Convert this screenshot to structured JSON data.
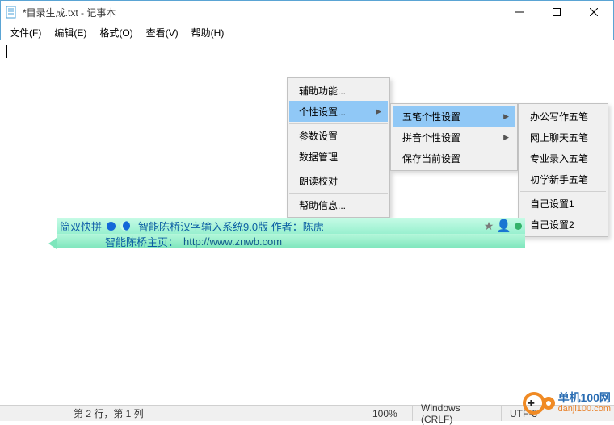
{
  "window": {
    "title": "*目录生成.txt - 记事本"
  },
  "menubar": [
    "文件(F)",
    "编辑(E)",
    "格式(O)",
    "查看(V)",
    "帮助(H)"
  ],
  "menu1": {
    "items": [
      "辅助功能...",
      "个性设置...",
      "参数设置",
      "数据管理",
      "朗读校对",
      "帮助信息..."
    ],
    "highlighted": 1,
    "submenu_indices": [
      1
    ],
    "separators_before": [
      2,
      4,
      5
    ]
  },
  "menu2": {
    "items": [
      "五笔个性设置",
      "拼音个性设置",
      "保存当前设置"
    ],
    "highlighted": 0,
    "submenu_indices": [
      0,
      1
    ]
  },
  "menu3": {
    "items": [
      "办公写作五笔",
      "网上聊天五笔",
      "专业录入五笔",
      "初学新手五笔",
      "自己设置1",
      "自己设置2"
    ],
    "separators_before": [
      4
    ]
  },
  "ime": {
    "mode": "简双快拼",
    "banner": "智能陈桥汉字输入系统9.0版    作者：陈虎",
    "homepage_label": "智能陈桥主页：",
    "homepage_url": "http://www.znwb.com"
  },
  "status": {
    "position": "第 2 行，第 1 列",
    "zoom": "100%",
    "eol": "Windows (CRLF)",
    "encoding": "UTF-8"
  },
  "watermark": {
    "line1": "单机100网",
    "line2": "danji100.com"
  }
}
